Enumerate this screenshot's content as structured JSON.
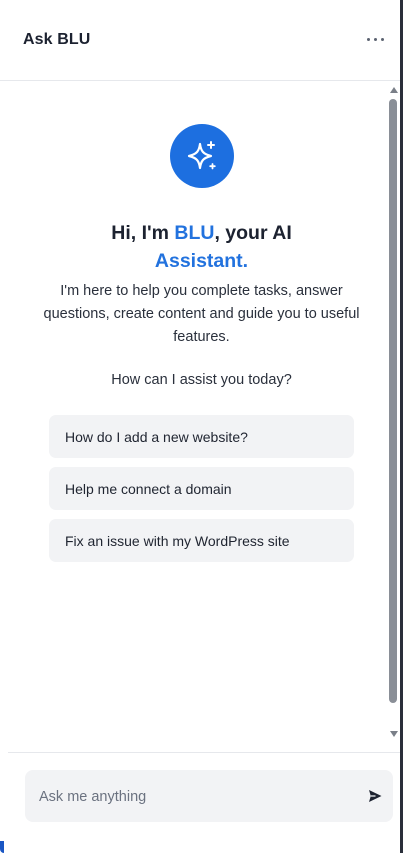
{
  "header": {
    "title": "Ask BLU",
    "menu_icon": "more-horizontal-icon"
  },
  "welcome": {
    "icon": "sparkles-icon",
    "greeting_prefix": "Hi, I'm ",
    "greeting_name": "BLU",
    "greeting_mid": ", your AI",
    "greeting_suffix": "Assistant.",
    "description": "I'm here to help you complete tasks, answer questions, create content and guide you to useful features.",
    "prompt": "How can I assist you today?"
  },
  "suggestions": [
    {
      "label": "How do I add a new website?"
    },
    {
      "label": "Help me connect a domain"
    },
    {
      "label": "Fix an issue with my WordPress site"
    }
  ],
  "composer": {
    "placeholder": "Ask me anything",
    "send_icon": "send-icon"
  },
  "colors": {
    "accent": "#2272de",
    "icon_circle": "#1d6fe0",
    "suggestion_bg": "#f2f3f5"
  }
}
